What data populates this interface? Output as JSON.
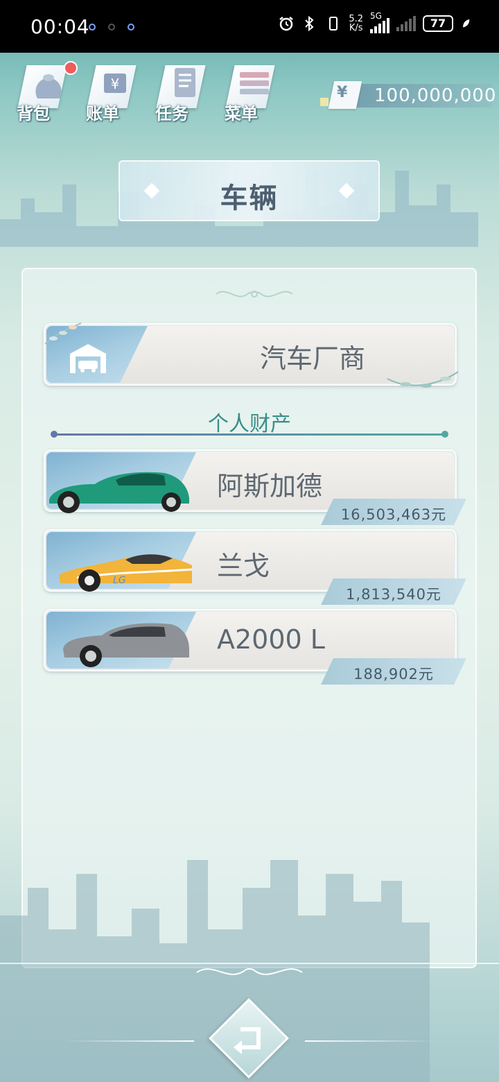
{
  "status_bar": {
    "time": "00:04",
    "net_speed_value": "5.2",
    "net_speed_unit": "K/s",
    "network": "5G",
    "battery": "77"
  },
  "top_menu": {
    "items": [
      {
        "label": "背包",
        "icon": "bag-icon"
      },
      {
        "label": "账单",
        "icon": "bill-icon"
      },
      {
        "label": "任务",
        "icon": "task-icon"
      },
      {
        "label": "菜单",
        "icon": "menu-icon"
      }
    ]
  },
  "money": {
    "currency_symbol": "¥",
    "value": "100,000,000"
  },
  "page_title": "车辆",
  "manufacturer": {
    "label": "汽车厂商",
    "icon": "garage-icon"
  },
  "section_title": "个人财产",
  "vehicles": [
    {
      "name": "阿斯加德",
      "price": "16,503,463元",
      "color": "#1f9a7b"
    },
    {
      "name": "兰戈",
      "price": "1,813,540元",
      "color": "#f2b43a"
    },
    {
      "name": "A2000 L",
      "price": "188,902元",
      "color": "#8e9296"
    }
  ],
  "back_icon": "return-icon"
}
